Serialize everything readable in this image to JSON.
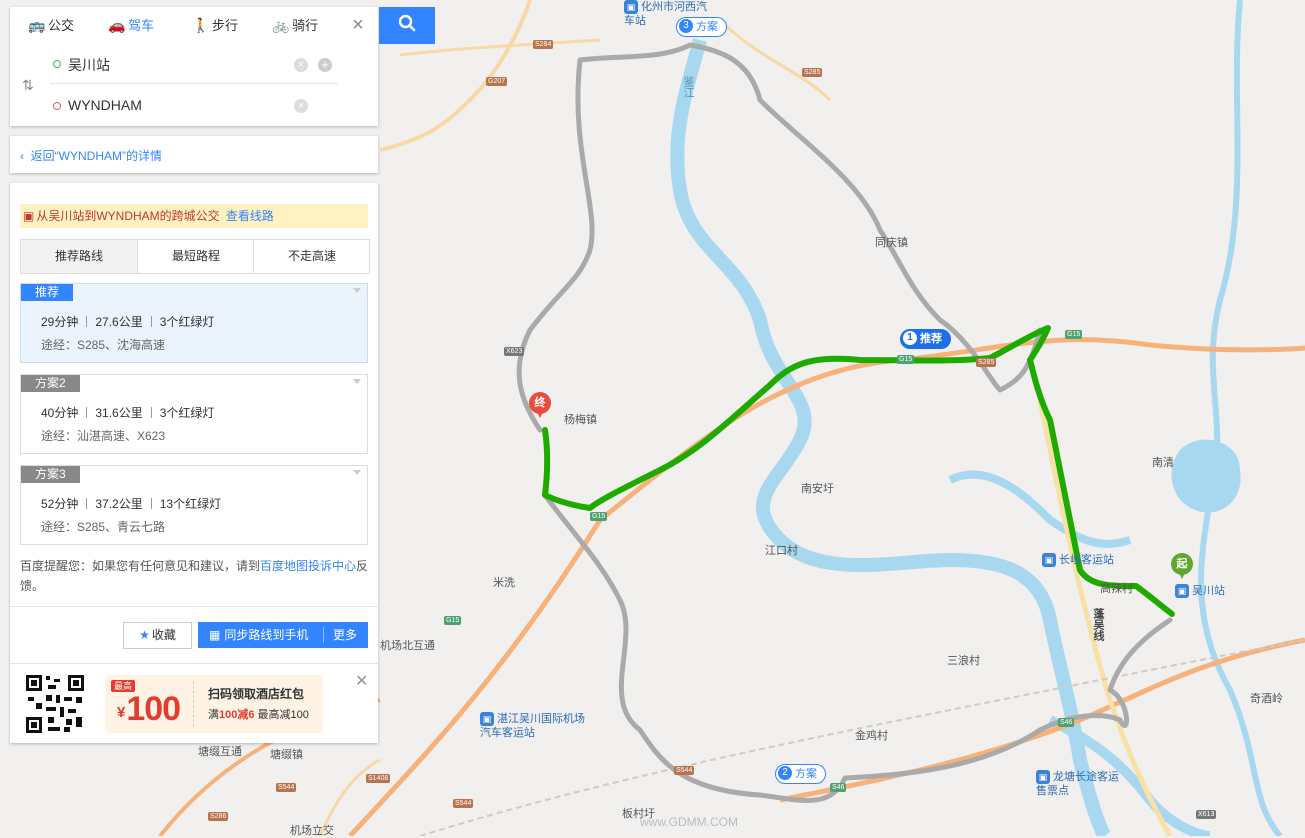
{
  "mode_tabs": [
    {
      "label": "公交",
      "icon": "bus-icon"
    },
    {
      "label": "驾车",
      "icon": "car-icon"
    },
    {
      "label": "步行",
      "icon": "walk-icon"
    },
    {
      "label": "骑行",
      "icon": "bike-icon"
    }
  ],
  "route_inputs": {
    "start": "吴川站",
    "end": "WYNDHAM"
  },
  "back_link": "返回“WYNDHAM”的详情",
  "notice": {
    "text": "从吴川站到WYNDHAM的跨城公交",
    "link": "查看线路"
  },
  "plan_tabs": [
    "推荐路线",
    "最短路程",
    "不走高速"
  ],
  "routes": [
    {
      "tag": "推荐",
      "time": "29分钟",
      "distance": "27.6公里",
      "lights": "3个红绿灯",
      "via": "途经：S285、沈海高速"
    },
    {
      "tag": "方案2",
      "time": "40分钟",
      "distance": "31.6公里",
      "lights": "3个红绿灯",
      "via": "途经：汕湛高速、X623"
    },
    {
      "tag": "方案3",
      "time": "52分钟",
      "distance": "37.2公里",
      "lights": "13个红绿灯",
      "via": "途经：S285、青云七路"
    }
  ],
  "feedback": {
    "prefix": "百度提醒您：如果您有任何意见和建议，请到",
    "link": "百度地图投诉中心",
    "suffix": "反馈。"
  },
  "buttons": {
    "favorite": "收藏",
    "sync": "同步路线到手机",
    "more": "更多"
  },
  "promo": {
    "tag": "最高",
    "currency": "¥",
    "amount": "100",
    "title": "扫码领取酒店红包",
    "sub_prefix": "满",
    "sub_highlight": "100减6",
    "sub_suffix": " 最高减100"
  },
  "map": {
    "bubbles": {
      "rec": {
        "num": "1",
        "label": "推荐"
      },
      "plan2": {
        "num": "2",
        "label": "方案"
      },
      "plan3": {
        "num": "3",
        "label": "方案"
      }
    },
    "markers": {
      "start": "起",
      "end": "终"
    },
    "places": {
      "yangmei": "杨梅镇",
      "tongqing": "同庆镇",
      "nanan": "南安圩",
      "jiangkou": "江口村",
      "nanqing": "南清",
      "sanlang": "三浪村",
      "jinji": "金鸡村",
      "qijiuling": "奇酒岭",
      "mixi": "米洗",
      "gaola": "高辣村",
      "tangdi": "塘缀互通",
      "tangdi_town": "塘缀镇",
      "airport_north": "机场北互通",
      "airport_interchange": "机场立交",
      "banqiao": "板村圩",
      "river_jian": "鉴江",
      "river_penwu": "蓬吴线"
    },
    "pois": {
      "huazhou": "化州市河西汽车站",
      "changqi": "长岐客运站",
      "wuchuan": "吴川站",
      "zhanjiang_airport": "湛江吴川国际机场汽车客运站",
      "longtang": "龙塘长途客运售票点"
    },
    "shields": {
      "s284": "S284",
      "g207": "G207",
      "s285a": "S285",
      "x623": "X623",
      "g15a": "G15",
      "s285b": "S285",
      "g15b": "G15",
      "g15c": "G15",
      "g15d": "G15",
      "s544a": "S544",
      "s46a": "S46",
      "s1408": "S1408",
      "s544b": "S544",
      "s544c": "S544",
      "s286": "S286",
      "s46b": "S46",
      "x613": "X613"
    },
    "watermark": "www.GDMM.COM"
  }
}
